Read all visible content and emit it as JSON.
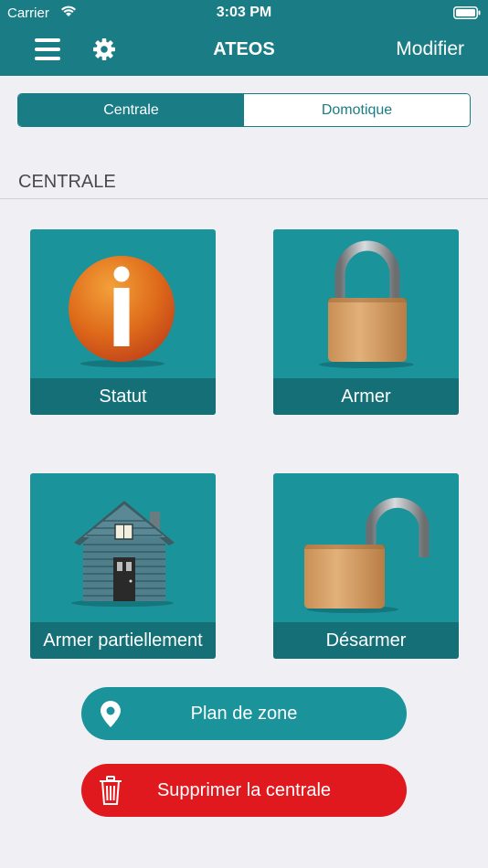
{
  "status_bar": {
    "carrier": "Carrier",
    "time": "3:03 PM"
  },
  "nav": {
    "title": "ATEOS",
    "edit_label": "Modifier",
    "color": "#1a7d85"
  },
  "segmented": {
    "tabs": [
      {
        "label": "Centrale",
        "active": true
      },
      {
        "label": "Domotique",
        "active": false
      }
    ]
  },
  "section": {
    "title": "CENTRALE"
  },
  "tiles": [
    {
      "label": "Statut",
      "icon": "info-icon"
    },
    {
      "label": "Armer",
      "icon": "locked-padlock-icon"
    },
    {
      "label": "Armer partiellement",
      "icon": "house-icon"
    },
    {
      "label": "Désarmer",
      "icon": "unlocked-padlock-icon"
    }
  ],
  "buttons": {
    "zone_plan": {
      "label": "Plan de zone",
      "icon": "location-pin-icon",
      "color": "#1a939b"
    },
    "delete": {
      "label": "Supprimer la centrale",
      "icon": "trash-icon",
      "color": "#e0191f"
    }
  }
}
